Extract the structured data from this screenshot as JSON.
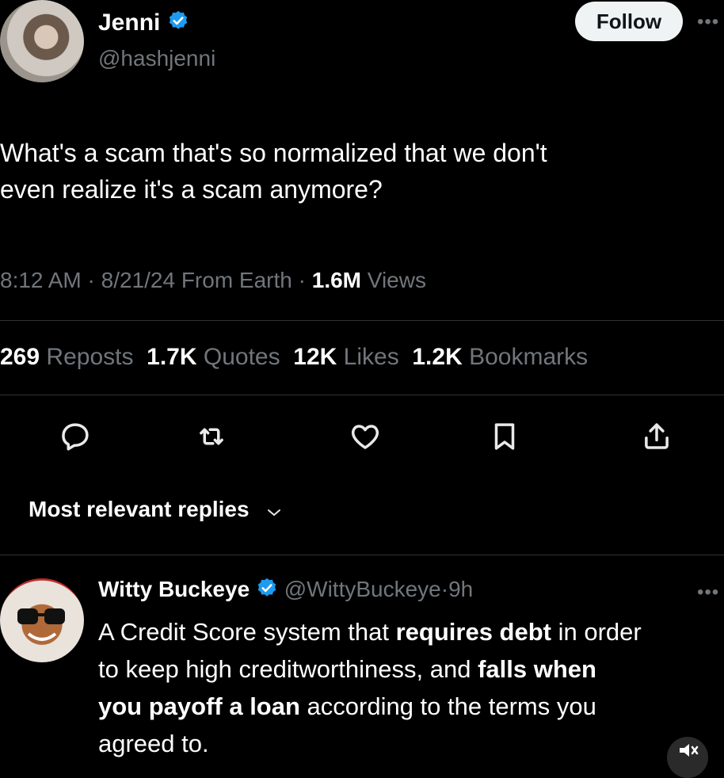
{
  "colors": {
    "background": "#000000",
    "text": "#e7e9ea",
    "muted": "#71767b",
    "verified": "#1d9bf0",
    "divider": "#2f3336"
  },
  "tweet": {
    "author_name": "Jenni",
    "author_handle": "@hashjenni",
    "follow_label": "Follow",
    "more_icon": "more-icon",
    "text_line1": "What's a scam that's so normalized that we don't",
    "text_line2": "even realize it's a scam anymore?",
    "time": "8:12 AM",
    "date": "8/21/24",
    "location": "From Earth",
    "views_count": "1.6M",
    "views_label": "Views",
    "sep": "·"
  },
  "stats": {
    "reposts_count": "269",
    "reposts_label": "Reposts",
    "quotes_count": "1.7K",
    "quotes_label": "Quotes",
    "likes_count": "12K",
    "likes_label": "Likes",
    "bookmarks_count": "1.2K",
    "bookmarks_label": "Bookmarks"
  },
  "actions": [
    "reply-icon",
    "repost-icon",
    "like-icon",
    "bookmark-icon",
    "share-icon"
  ],
  "replies_sort": {
    "label": "Most relevant replies",
    "icon": "chevron-down-icon"
  },
  "reply": {
    "author_name": "Witty Buckeye",
    "author_handle": "@WittyBuckeye",
    "sep": "·",
    "age": "9h",
    "t1": "A Credit Score system that ",
    "b1": "requires debt",
    "t2": " in order",
    "t3": "to keep high creditworthiness, and ",
    "b2": "falls when",
    "b3": "you payoff a loan",
    "t4": " according to the terms you",
    "t5": "agreed to."
  }
}
